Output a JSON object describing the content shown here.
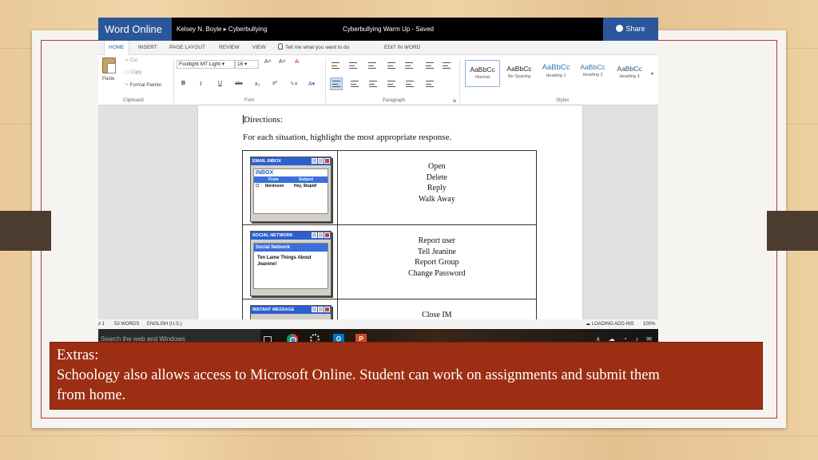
{
  "slide": {
    "caption_title": "Extras:",
    "caption_lines": [
      "Schoology also allows access to Microsoft Online. Student can work on assignments and submit them",
      "from home."
    ],
    "colors": {
      "caption_bg": "#9c2e13",
      "frame": "#b5382a",
      "word_blue": "#2b579a"
    }
  },
  "word": {
    "app_name": "Word Online",
    "breadcrumb": "Kelsey N. Boyle ▸ Cyberbullying",
    "doc_title": "Cyberbullying Warm Up  -  Saved",
    "share_label": "Share",
    "tabs": [
      "HOME",
      "INSERT",
      "PAGE LAYOUT",
      "REVIEW",
      "VIEW"
    ],
    "tell_me": "Tell me what you want to do",
    "edit_in_word": "EDIT IN WORD",
    "clipboard": {
      "paste": "Paste",
      "cut": "Cut",
      "copy": "Copy",
      "format_painter": "Format Painter",
      "group": "Clipboard"
    },
    "font": {
      "name": "Footlight MT Light",
      "size": "16",
      "group": "Font"
    },
    "paragraph_group": "Paragraph",
    "styles": {
      "group": "Styles",
      "items": [
        {
          "sample": "AaBbCc",
          "name": "Normal"
        },
        {
          "sample": "AaBbCc",
          "name": "No Spacing"
        },
        {
          "sample": "AaBbCc",
          "name": "Heading 1"
        },
        {
          "sample": "AaBbCc",
          "name": "Heading 2"
        },
        {
          "sample": "AaBbCc",
          "name": "Heading 3"
        }
      ]
    }
  },
  "document": {
    "heading": "Directions:",
    "instruction": "For each situation, highlight the most appropriate response.",
    "rows": [
      {
        "window_title": "EMAIL INBOX",
        "inbox_title": "INBOX",
        "col_from": "From",
        "col_subject": "Subject",
        "sender": "blevinson",
        "subject": "Hey, Stupid!",
        "options": [
          "Open",
          "Delete",
          "Reply",
          "Walk Away"
        ]
      },
      {
        "window_title": "SOCIAL NETWORK",
        "header": "Social Network",
        "content": "Ten Lame Things About Jeanine!",
        "options": [
          "Report user",
          "Tell Jeanine",
          "Report Group",
          "Change Password"
        ]
      },
      {
        "window_title": "INSTANT MESSAGE",
        "options": [
          "Close IM"
        ]
      }
    ]
  },
  "status": {
    "page": "♯ 1",
    "words": "53 WORDS",
    "language": "ENGLISH (U.S.)",
    "addins": "LOADING ADD-INS",
    "zoom": "100%"
  },
  "taskbar": {
    "search_placeholder": "Search the web and Windows",
    "tray": "∧ ☁ ◔ ♪ ✉"
  }
}
